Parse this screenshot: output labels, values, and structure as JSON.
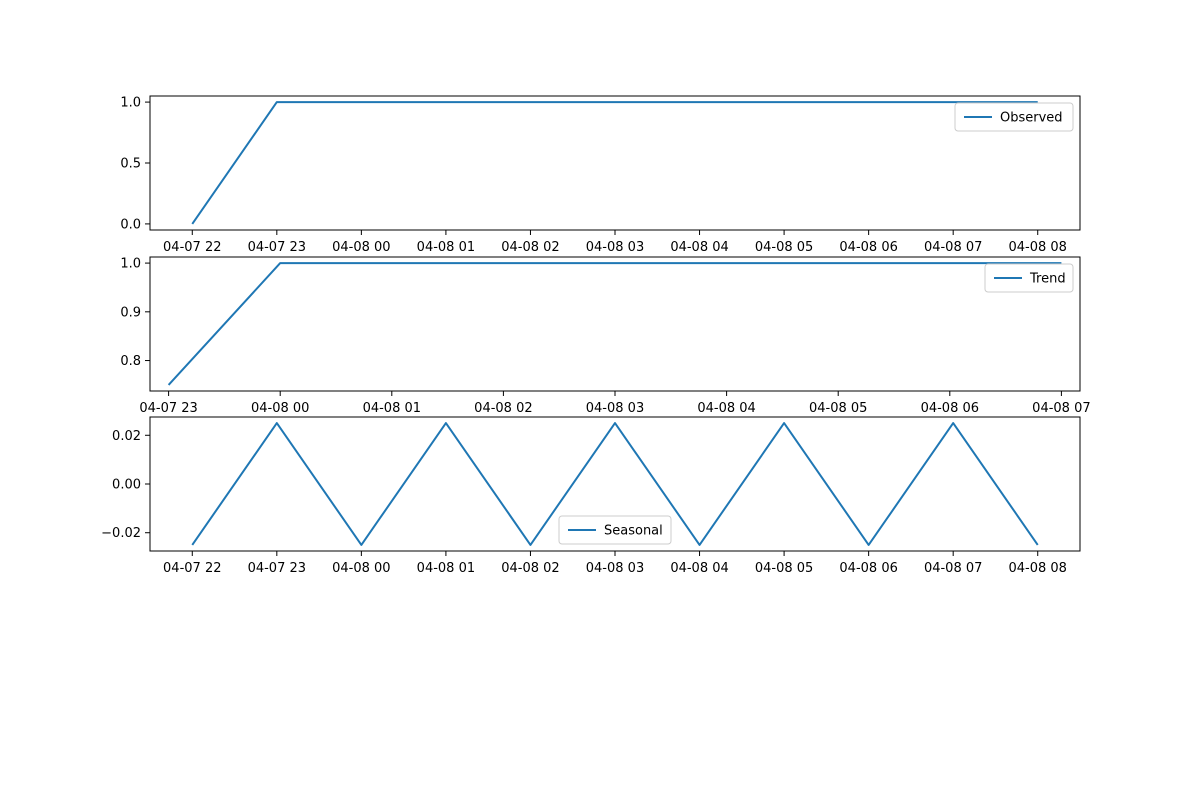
{
  "colors": {
    "series": "#1f77b4",
    "axes": "#000000",
    "background": "#ffffff"
  },
  "chart_data": [
    {
      "type": "line",
      "title": "",
      "xlabel": "",
      "ylabel": "",
      "x_axis_kind": "datetime",
      "xlim": [
        "2024-04-07T21:30",
        "2024-04-08T08:30"
      ],
      "x_ticks": [
        "2024-04-07T22:00",
        "2024-04-07T23:00",
        "2024-04-08T00:00",
        "2024-04-08T01:00",
        "2024-04-08T02:00",
        "2024-04-08T03:00",
        "2024-04-08T04:00",
        "2024-04-08T05:00",
        "2024-04-08T06:00",
        "2024-04-08T07:00",
        "2024-04-08T08:00"
      ],
      "x_tick_labels": [
        "04-07 22",
        "04-07 23",
        "04-08 00",
        "04-08 01",
        "04-08 02",
        "04-08 03",
        "04-08 04",
        "04-08 05",
        "04-08 06",
        "04-08 07",
        "04-08 08"
      ],
      "ylim": [
        -0.05,
        1.05
      ],
      "y_ticks": [
        0.0,
        0.5,
        1.0
      ],
      "y_tick_labels": [
        "0.0",
        "0.5",
        "1.0"
      ],
      "grid": false,
      "legend_position": "upper right",
      "series": [
        {
          "name": "Observed",
          "x": [
            "2024-04-07T22:00",
            "2024-04-07T23:00",
            "2024-04-08T00:00",
            "2024-04-08T01:00",
            "2024-04-08T02:00",
            "2024-04-08T03:00",
            "2024-04-08T04:00",
            "2024-04-08T05:00",
            "2024-04-08T06:00",
            "2024-04-08T07:00",
            "2024-04-08T08:00"
          ],
          "y": [
            0,
            1,
            1,
            1,
            1,
            1,
            1,
            1,
            1,
            1,
            1
          ]
        }
      ]
    },
    {
      "type": "line",
      "title": "",
      "xlabel": "",
      "ylabel": "",
      "x_axis_kind": "datetime",
      "xlim": [
        "2024-04-07T22:50",
        "2024-04-08T07:10"
      ],
      "x_ticks": [
        "2024-04-07T23:00",
        "2024-04-08T00:00",
        "2024-04-08T01:00",
        "2024-04-08T02:00",
        "2024-04-08T03:00",
        "2024-04-08T04:00",
        "2024-04-08T05:00",
        "2024-04-08T06:00",
        "2024-04-08T07:00"
      ],
      "x_tick_labels": [
        "04-07 23",
        "04-08 00",
        "04-08 01",
        "04-08 02",
        "04-08 03",
        "04-08 04",
        "04-08 05",
        "04-08 06",
        "04-08 07"
      ],
      "ylim": [
        0.7375,
        1.0125
      ],
      "y_ticks": [
        0.8,
        0.9,
        1.0
      ],
      "y_tick_labels": [
        "0.8",
        "0.9",
        "1.0"
      ],
      "grid": false,
      "legend_position": "upper right",
      "series": [
        {
          "name": "Trend",
          "x": [
            "2024-04-07T23:00",
            "2024-04-08T00:00",
            "2024-04-08T01:00",
            "2024-04-08T02:00",
            "2024-04-08T03:00",
            "2024-04-08T04:00",
            "2024-04-08T05:00",
            "2024-04-08T06:00",
            "2024-04-08T07:00"
          ],
          "y": [
            0.75,
            1,
            1,
            1,
            1,
            1,
            1,
            1,
            1
          ]
        }
      ]
    },
    {
      "type": "line",
      "title": "",
      "xlabel": "",
      "ylabel": "",
      "x_axis_kind": "datetime",
      "xlim": [
        "2024-04-07T21:30",
        "2024-04-08T08:30"
      ],
      "x_ticks": [
        "2024-04-07T22:00",
        "2024-04-07T23:00",
        "2024-04-08T00:00",
        "2024-04-08T01:00",
        "2024-04-08T02:00",
        "2024-04-08T03:00",
        "2024-04-08T04:00",
        "2024-04-08T05:00",
        "2024-04-08T06:00",
        "2024-04-08T07:00",
        "2024-04-08T08:00"
      ],
      "x_tick_labels": [
        "04-07 22",
        "04-07 23",
        "04-08 00",
        "04-08 01",
        "04-08 02",
        "04-08 03",
        "04-08 04",
        "04-08 05",
        "04-08 06",
        "04-08 07",
        "04-08 08"
      ],
      "ylim": [
        -0.0275,
        0.0275
      ],
      "y_ticks": [
        -0.02,
        0.0,
        0.02
      ],
      "y_tick_labels": [
        "−0.02",
        "0.00",
        "0.02"
      ],
      "grid": false,
      "legend_position": "lower center",
      "series": [
        {
          "name": "Seasonal",
          "x": [
            "2024-04-07T22:00",
            "2024-04-07T23:00",
            "2024-04-08T00:00",
            "2024-04-08T01:00",
            "2024-04-08T02:00",
            "2024-04-08T03:00",
            "2024-04-08T04:00",
            "2024-04-08T05:00",
            "2024-04-08T06:00",
            "2024-04-08T07:00",
            "2024-04-08T08:00"
          ],
          "y": [
            -0.025,
            0.025,
            -0.025,
            0.025,
            -0.025,
            0.025,
            -0.025,
            0.025,
            -0.025,
            0.025,
            -0.025
          ]
        }
      ]
    }
  ]
}
